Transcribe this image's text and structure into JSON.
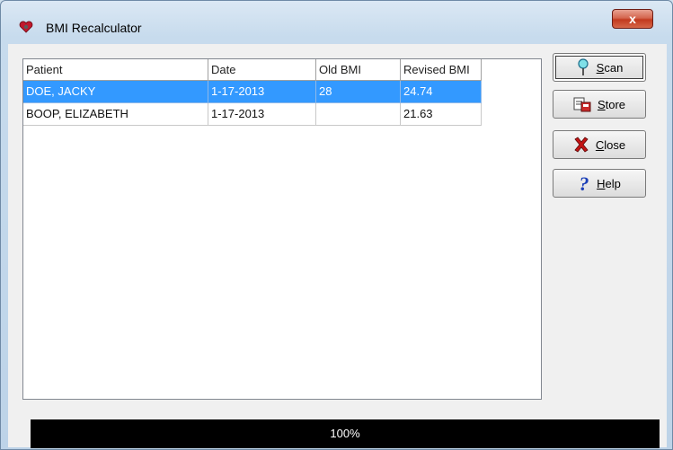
{
  "window": {
    "title": "BMI Recalculator",
    "close_glyph": "x"
  },
  "table": {
    "columns": [
      "Patient",
      "Date",
      "Old BMI",
      "Revised BMI"
    ],
    "rows": [
      {
        "patient": "DOE, JACKY",
        "date": "1-17-2013",
        "old_bmi": "28",
        "revised_bmi": "24.74",
        "selected": true
      },
      {
        "patient": "BOOP, ELIZABETH",
        "date": "1-17-2013",
        "old_bmi": "",
        "revised_bmi": "21.63",
        "selected": false
      }
    ]
  },
  "buttons": {
    "scan": {
      "accel": "S",
      "rest": "can",
      "icon": "pin-icon"
    },
    "store": {
      "accel": "S",
      "pre": "",
      "post": "tore",
      "icon": "store-icon"
    },
    "close": {
      "accel": "C",
      "rest": "lose",
      "icon": "red-x-icon"
    },
    "help": {
      "accel": "H",
      "rest": "elp",
      "icon": "question-icon"
    }
  },
  "progress": {
    "fraction": 1.0,
    "label": "100%"
  },
  "colors": {
    "selection": "#3399ff",
    "close_button": "#c2391e",
    "progress_bg": "#000000"
  }
}
